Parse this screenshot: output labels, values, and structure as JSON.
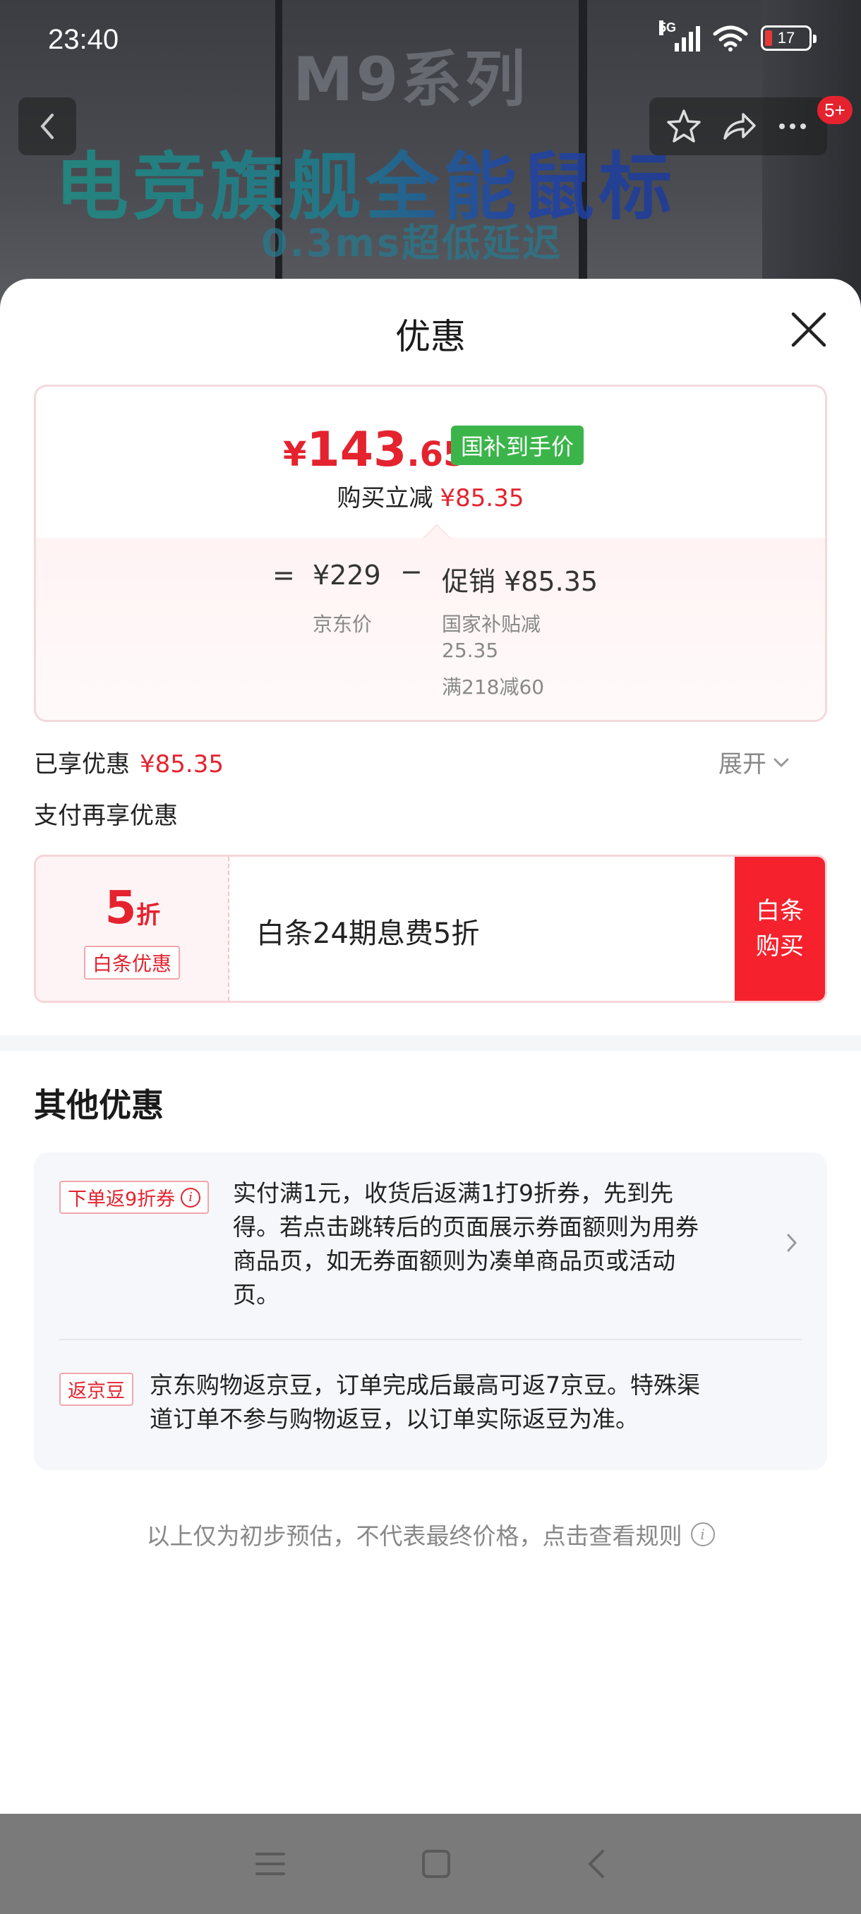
{
  "status_bar": {
    "time": "23:40",
    "network": "5G",
    "battery": "17"
  },
  "banner": {
    "series": "M9系列",
    "headline": "电竞旗舰全能鼠标",
    "latency": "0.3ms超低延迟"
  },
  "nav": {
    "badge": "5+"
  },
  "sheet": {
    "title": "优惠",
    "price_card": {
      "currency": "¥",
      "price_int": "143",
      "price_dec": ".65",
      "subsidy_tag": "国补到手价",
      "instant_off_label": "购买立减",
      "instant_off_amount": "¥85.35",
      "eq_sign": "=",
      "base_price": "¥229",
      "minus_sign": "−",
      "promo": "促销 ¥85.35",
      "base_label": "京东价",
      "promo_detail_1": "国家补贴减",
      "promo_detail_2": "25.35",
      "promo_detail_3": "满218减60"
    },
    "enjoyed_label": "已享优惠",
    "enjoyed_amount": "¥85.35",
    "expand_label": "展开",
    "pay_more_label": "支付再享优惠",
    "coupon": {
      "discount_num": "5",
      "discount_unit": "折",
      "tag": "白条优惠",
      "desc": "白条24期息费5折",
      "buy_line1": "白条",
      "buy_line2": "购买"
    },
    "other_title": "其他优惠",
    "offers": [
      {
        "tag": "下单返9折券",
        "lines": [
          "实付满1元，收货后返满1打9折券，先到先",
          "得。若点击跳转后的页面展示券面额则为用券",
          "商品页，如无券面额则为凑单商品页或活动",
          "页。"
        ]
      },
      {
        "tag": "返京豆",
        "lines": [
          "京东购物返京豆，订单完成后最高可返7京豆。特殊渠",
          "道订单不参与购物返豆，以订单实际返豆为准。"
        ]
      }
    ],
    "footnote": "以上仅为初步预估，不代表最终价格，点击查看规则"
  },
  "colors": {
    "accent_red": "#e4232f",
    "subsidy_green": "#3bb54a",
    "buy_red": "#f5222d"
  }
}
